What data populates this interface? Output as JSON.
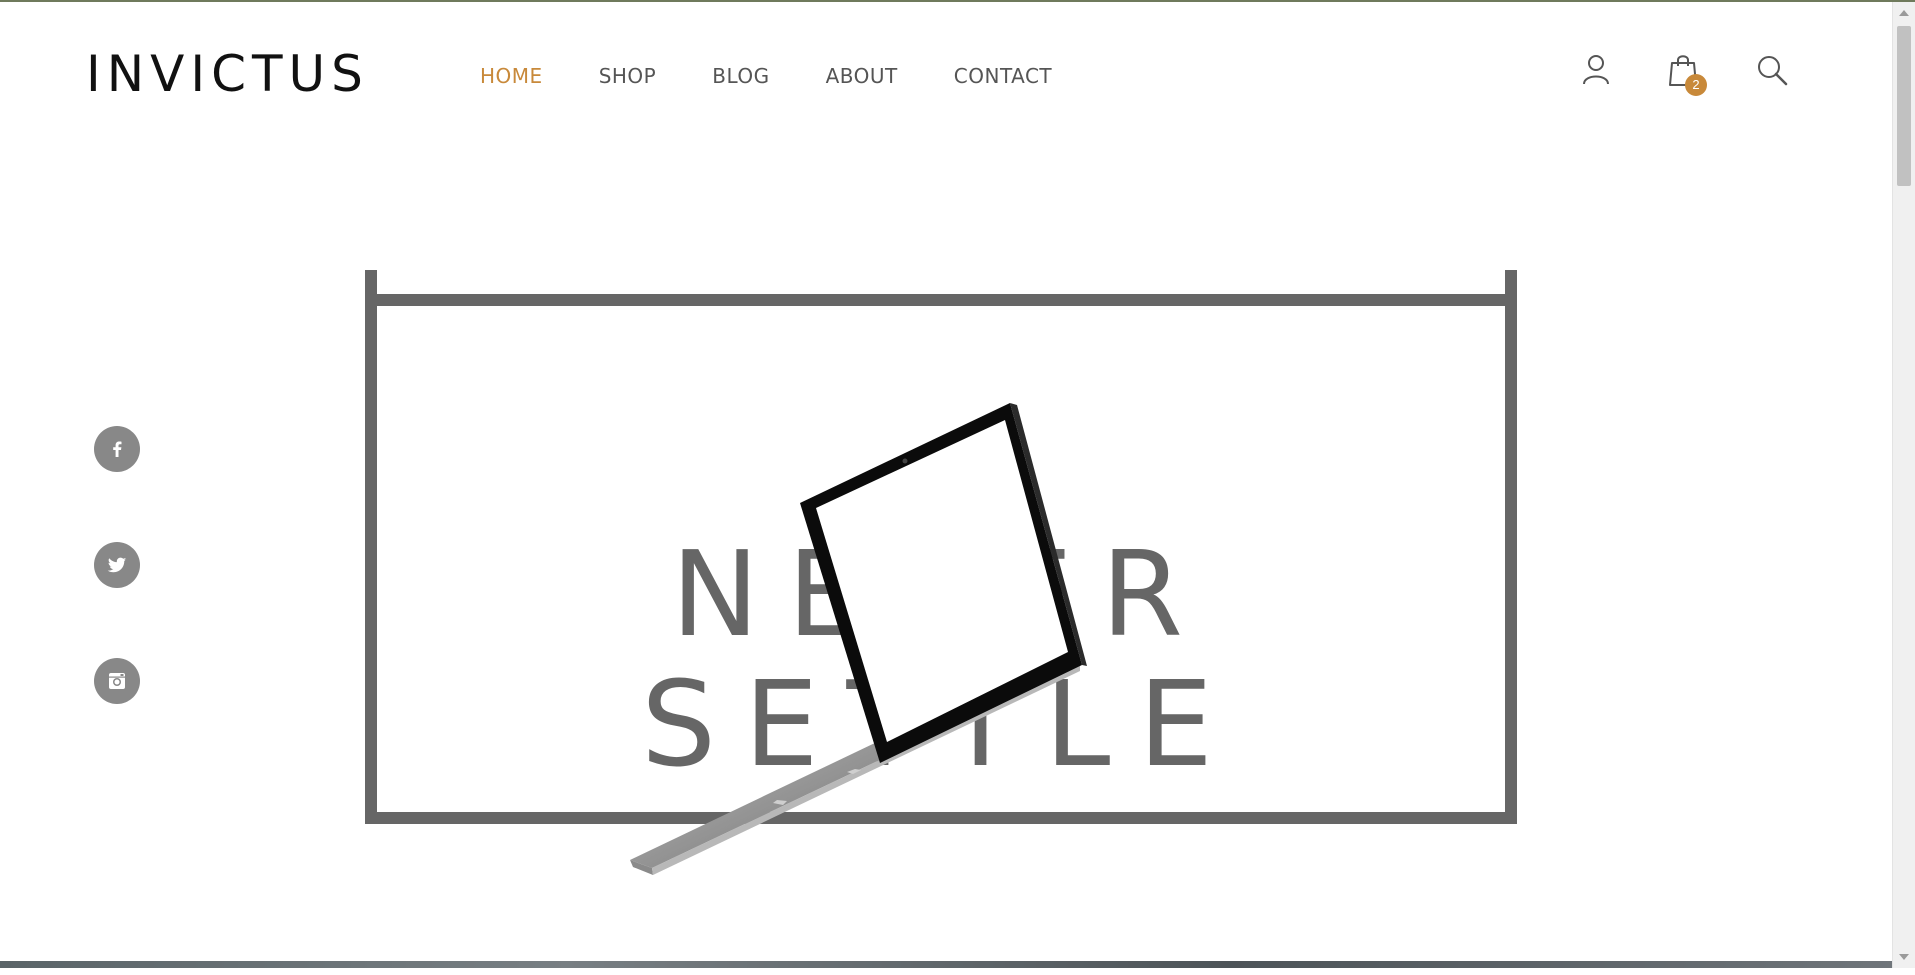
{
  "brand": {
    "logo": "INVICTUS"
  },
  "nav": {
    "items": [
      {
        "label": "HOME",
        "active": true
      },
      {
        "label": "SHOP",
        "active": false
      },
      {
        "label": "BLOG",
        "active": false
      },
      {
        "label": "ABOUT",
        "active": false
      },
      {
        "label": "CONTACT",
        "active": false
      }
    ]
  },
  "header_icons": {
    "account": "user-icon",
    "cart": "shopping-bag-icon",
    "cart_count": "2",
    "search": "search-icon"
  },
  "social": [
    {
      "icon": "facebook-icon"
    },
    {
      "icon": "twitter-icon"
    },
    {
      "icon": "instagram-icon"
    }
  ],
  "hero": {
    "title": "NEVER SETTLE"
  },
  "colors": {
    "accent": "#c8893a",
    "frame": "#666666",
    "text": "#555555",
    "social_bg": "#888888",
    "logo": "#111111"
  }
}
